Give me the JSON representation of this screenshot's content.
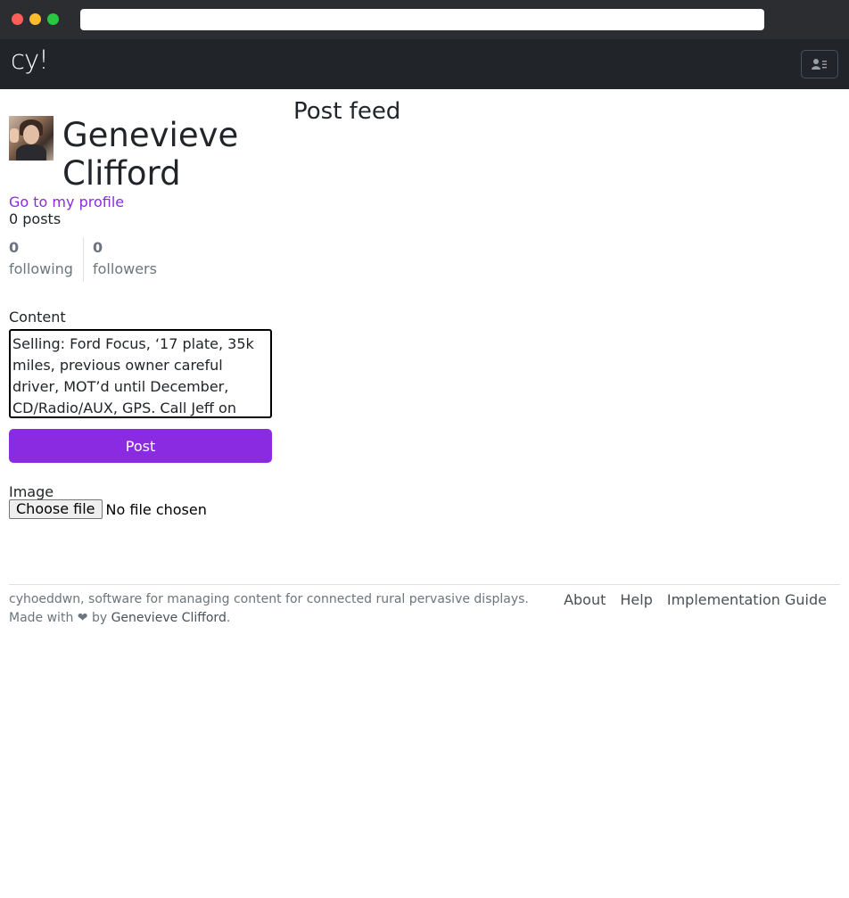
{
  "browser": {
    "url": ""
  },
  "navbar": {
    "brand": "cy!",
    "menu_icon": "user-list-icon"
  },
  "profile": {
    "name": "Genevieve Clifford",
    "profile_link": "Go to my profile",
    "posts": "0 posts",
    "following_count": "0",
    "following_label": "following",
    "followers_count": "0",
    "followers_label": "followers"
  },
  "composer": {
    "content_label": "Content",
    "content_value": "Selling: Ford Focus, ‘17 plate, 35k miles, previous owner careful driver, MOT’d until December, CD/Radio/AUX, GPS. Call Jeff on",
    "post_label": "Post",
    "image_label": "Image",
    "file_button": "Choose file",
    "file_status": "No file chosen"
  },
  "feed": {
    "title": "Post feed"
  },
  "footer": {
    "description": "cyhoeddwn, software for managing content for connected rural pervasive displays.",
    "made_with": "Made with",
    "heart": "❤",
    "by": "by",
    "author": "Genevieve Clifford",
    "period": ".",
    "links": [
      "About",
      "Help",
      "Implementation Guide"
    ]
  },
  "colors": {
    "accent": "#8a2be2",
    "navbar": "#212529",
    "muted": "#6c757d"
  }
}
